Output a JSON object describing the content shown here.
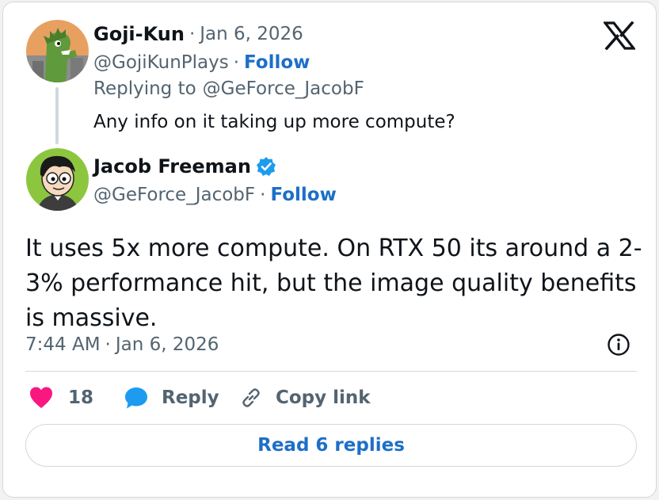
{
  "parent_tweet": {
    "display_name": "Goji-Kun",
    "date": "Jan 6, 2026",
    "handle": "@GojiKunPlays",
    "follow_label": "Follow",
    "replying_prefix": "Replying to",
    "replying_to": "@GeForce_JacobF",
    "text": "Any info on it taking up more compute?"
  },
  "reply_tweet": {
    "display_name": "Jacob Freeman",
    "verified": true,
    "handle": "@GeForce_JacobF",
    "follow_label": "Follow",
    "text": "It uses 5x more compute. On RTX 50 its around a 2-3% performance hit, but the image quality benefits is massive.",
    "time": "7:44 AM",
    "date": "Jan 6, 2026"
  },
  "actions": {
    "like_count": "18",
    "reply_label": "Reply",
    "copy_link_label": "Copy link",
    "read_replies_label": "Read 6 replies"
  },
  "icons": {
    "brand": "x-logo-icon",
    "verified": "verified-badge-icon",
    "info": "info-icon",
    "like": "heart-icon",
    "reply": "reply-bubble-icon",
    "copy": "link-icon"
  },
  "colors": {
    "link_blue": "#1d6fc7",
    "verified_blue": "#1d9bf0",
    "heart_pink": "#f91880",
    "muted_gray": "#536471"
  }
}
